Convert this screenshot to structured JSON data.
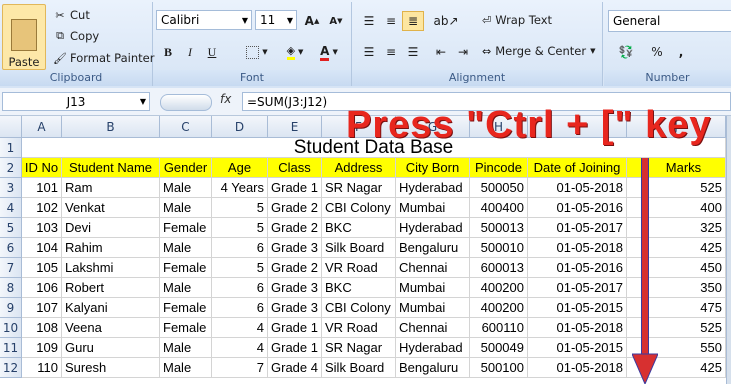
{
  "ribbon": {
    "clipboard": {
      "label": "Clipboard",
      "paste": "Paste",
      "cut": "Cut",
      "copy": "Copy",
      "format_painter": "Format Painter"
    },
    "font": {
      "label": "Font",
      "family": "Calibri",
      "size": "11",
      "bold": "B",
      "italic": "I",
      "underline": "U",
      "grow": "A",
      "shrink": "A"
    },
    "alignment": {
      "label": "Alignment",
      "wrap_text": "Wrap Text",
      "merge_center": "Merge & Center"
    },
    "number": {
      "label": "Number",
      "format": "General",
      "percent": "%",
      "comma": ","
    }
  },
  "formula_bar": {
    "name_box": "J13",
    "fx": "fx",
    "formula": "=SUM(J3:J12)"
  },
  "columns": [
    "A",
    "B",
    "C",
    "D",
    "E",
    "F",
    "G",
    "H",
    "I",
    "J"
  ],
  "title": "Student Data Base",
  "headers": [
    "ID No",
    "Student Name",
    "Gender",
    "Age",
    "Class",
    "Address",
    "City Born",
    "Pincode",
    "Date of Joining",
    "",
    "Marks"
  ],
  "rows": [
    [
      "101",
      "Ram",
      "Male",
      "4 Years",
      "Grade 1",
      "SR Nagar",
      "Hyderabad",
      "500050",
      "01-05-2018",
      "525"
    ],
    [
      "102",
      "Venkat",
      "Male",
      "5",
      "Grade 2",
      "CBI Colony",
      "Mumbai",
      "400400",
      "01-05-2016",
      "400"
    ],
    [
      "103",
      "Devi",
      "Female",
      "5",
      "Grade 2",
      "BKC",
      "Hyderabad",
      "500013",
      "01-05-2017",
      "325"
    ],
    [
      "104",
      "Rahim",
      "Male",
      "6",
      "Grade 3",
      "Silk Board",
      "Bengaluru",
      "500010",
      "01-05-2018",
      "425"
    ],
    [
      "105",
      "Lakshmi",
      "Female",
      "5",
      "Grade 2",
      "VR Road",
      "Chennai",
      "600013",
      "01-05-2016",
      "450"
    ],
    [
      "106",
      "Robert",
      "Male",
      "6",
      "Grade 3",
      "BKC",
      "Mumbai",
      "400200",
      "01-05-2017",
      "350"
    ],
    [
      "107",
      "Kalyani",
      "Female",
      "6",
      "Grade 3",
      "CBI Colony",
      "Mumbai",
      "400200",
      "01-05-2015",
      "475"
    ],
    [
      "108",
      "Veena",
      "Female",
      "4",
      "Grade 1",
      "VR Road",
      "Chennai",
      "600110",
      "01-05-2018",
      "525"
    ],
    [
      "109",
      "Guru",
      "Male",
      "4",
      "Grade 1",
      "SR Nagar",
      "Hyderabad",
      "500049",
      "01-05-2015",
      "550"
    ],
    [
      "110",
      "Suresh",
      "Male",
      "7",
      "Grade 4",
      "Silk Board",
      "Bengaluru",
      "500100",
      "01-05-2018",
      "425"
    ]
  ],
  "row_numbers": [
    "1",
    "2",
    "3",
    "4",
    "5",
    "6",
    "7",
    "8",
    "9",
    "10",
    "11",
    "12"
  ],
  "overlay_text": "Press \"Ctrl + [\" key",
  "colors": {
    "header_fill": "#ffff00",
    "overlay": "#e8261e",
    "ribbon": "#dbe7f6"
  }
}
